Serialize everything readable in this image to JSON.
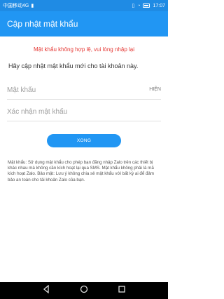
{
  "status_bar": {
    "carrier": "中国移动4G",
    "time": "17:07"
  },
  "app_bar": {
    "title": "Cập nhật mật khẩu"
  },
  "error_message": "Mật khẩu không hợp lệ, vui lòng nhập lại",
  "instruction": "Hãy cập nhật mật khẩu mới cho tài khoản này.",
  "password_field": {
    "placeholder": "Mật khẩu",
    "toggle_label": "HIỆN"
  },
  "confirm_field": {
    "placeholder": "Xác nhận mật khẩu"
  },
  "submit_label": "XONG",
  "note_text": "Mật khẩu: Sử dụng mật khẩu cho phép bạn đăng nhập Zalo trên các thiết bị khác nhau mà không cần kích hoạt lại qua SMS. Mật khẩu không phải là mã kích hoạt Zalo. Bảo mật: Lưu ý không chia sẻ mật khẩu với bất kỳ ai để đảm bảo an toàn cho tài khoản Zalo của bạn."
}
